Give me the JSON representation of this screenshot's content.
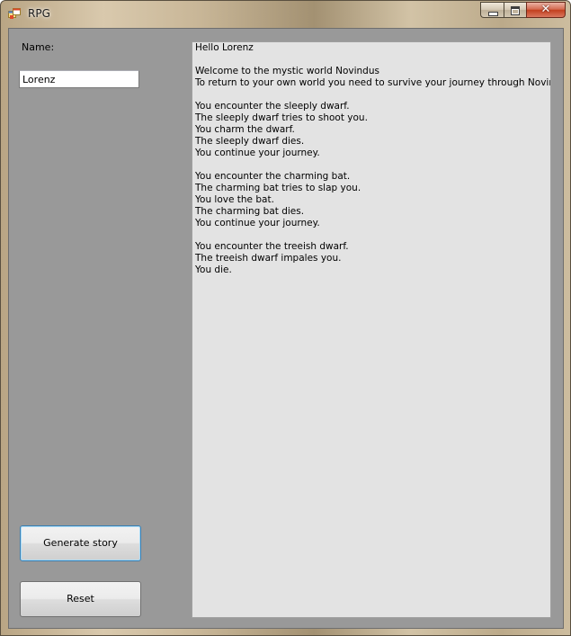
{
  "window": {
    "title": "RPG",
    "icon": "app-window-icon",
    "caption": {
      "minimize": "minimize-icon",
      "maximize": "maximize-icon",
      "close": "close-icon",
      "close_glyph": "✕"
    }
  },
  "form": {
    "name_label": "Name:",
    "name_value": "Lorenz",
    "generate_label": "Generate story",
    "reset_label": "Reset"
  },
  "story": {
    "lines": [
      "Hello Lorenz",
      "",
      "Welcome to the mystic world Novindus",
      "To return to your own world you need to survive your journey through Novindus",
      "",
      "You encounter the sleeply dwarf.",
      "The sleeply dwarf tries to shoot you.",
      "You charm the dwarf.",
      "The sleeply dwarf dies.",
      "You continue your journey.",
      "",
      "You encounter the charming bat.",
      "The charming bat tries to slap you.",
      "You love the bat.",
      "The charming bat dies.",
      "You continue your journey.",
      "",
      "You encounter the treeish dwarf.",
      "The treeish dwarf impales you.",
      "You die."
    ]
  },
  "colors": {
    "client_background": "#999999",
    "story_background": "#e3e3e3",
    "close_button": "#c3401f",
    "focus_border": "#3c7fb1"
  }
}
